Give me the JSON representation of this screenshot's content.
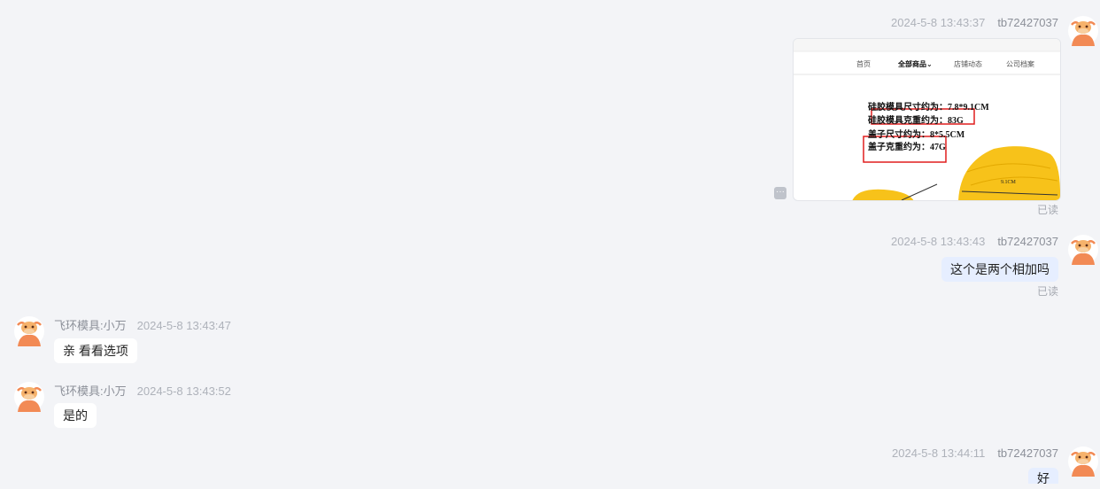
{
  "colors": {
    "background": "#f3f4f7",
    "outgoing_bubble": "#e6eeff",
    "incoming_bubble": "#ffffff",
    "avatar_face": "#f28a55"
  },
  "messages": [
    {
      "time": "2024-5-8 13:43:37",
      "sender": "tb72427037",
      "type": "image",
      "read": "已读",
      "more_icon": "···"
    },
    {
      "time": "2024-5-8 13:43:43",
      "sender": "tb72427037",
      "text": "这个是两个相加吗",
      "read": "已读"
    },
    {
      "time": "2024-5-8 13:43:47",
      "sender": "飞环模具:小万",
      "text": "亲 看看选项"
    },
    {
      "time": "2024-5-8 13:43:52",
      "sender": "飞环模具:小万",
      "text": "是的"
    },
    {
      "time": "2024-5-8 13:44:11",
      "sender": "tb72427037",
      "text": "好"
    }
  ],
  "image_content": {
    "nav": [
      "首页",
      "全部商品",
      "店铺动态",
      "公司档案"
    ],
    "nav_chevron": "⌄",
    "specs": [
      "硅胶模具尺寸约为：7.8*9.1CM",
      "硅胶模具克重约为：83G",
      "盖子尺寸约为：8*5.5CM",
      "盖子克重约为：47G"
    ],
    "dimension_label": "9.1CM"
  }
}
